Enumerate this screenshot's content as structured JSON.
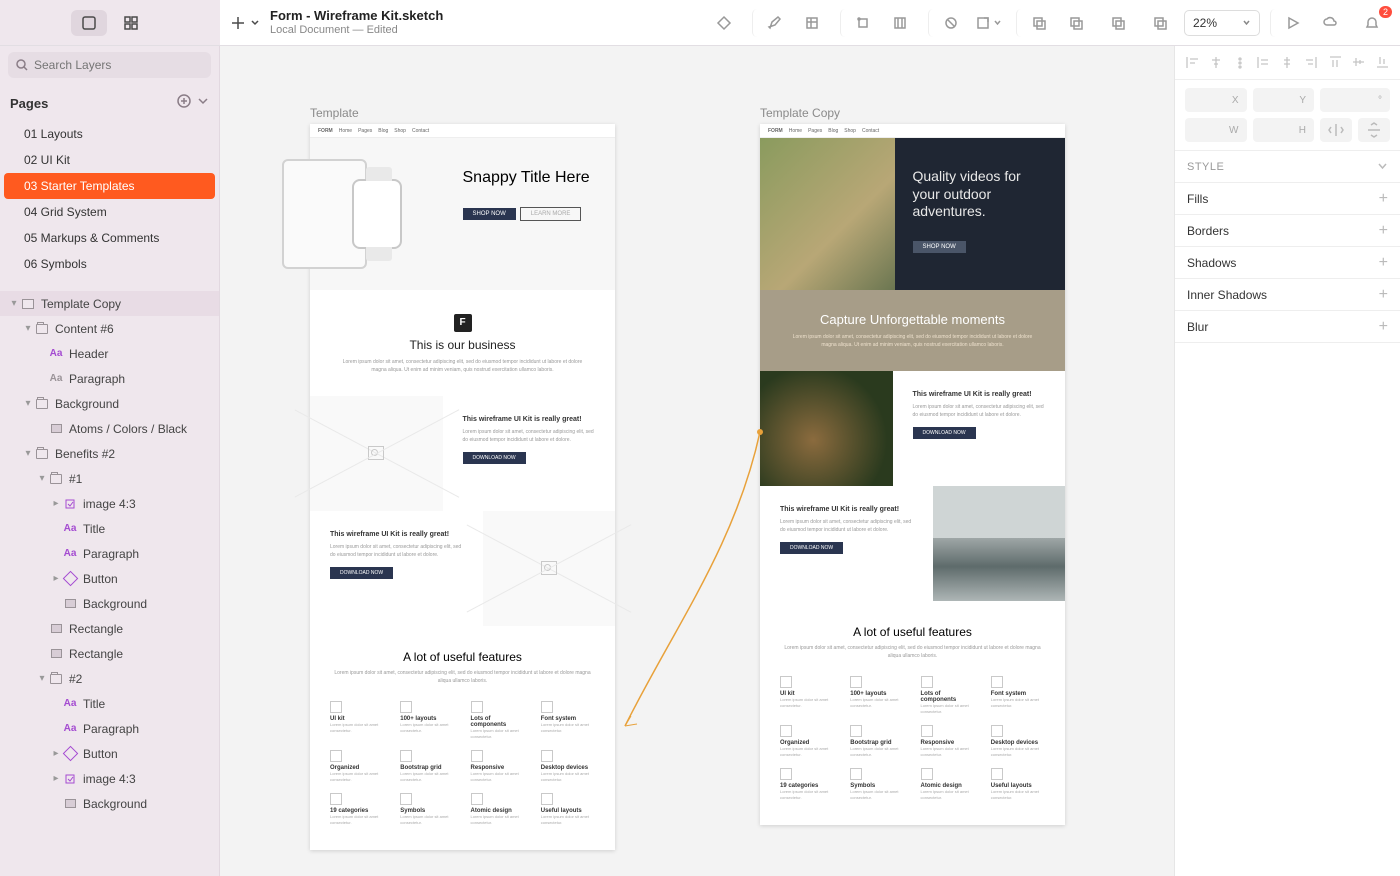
{
  "doc": {
    "title": "Form - Wireframe Kit.sketch",
    "subtitle": "Local Document — Edited"
  },
  "zoom": "22%",
  "notif_count": "2",
  "search_placeholder": "Search Layers",
  "pages_label": "Pages",
  "pages": [
    "01 Layouts",
    "02 UI Kit",
    "03 Starter Templates",
    "04 Grid System",
    "05 Markups & Comments",
    "06 Symbols"
  ],
  "active_page_index": 2,
  "layers": [
    {
      "d": 0,
      "kind": "artboard",
      "label": "Template Copy",
      "open": true,
      "sel": true
    },
    {
      "d": 1,
      "kind": "folder",
      "label": "Content #6",
      "open": true
    },
    {
      "d": 2,
      "kind": "text",
      "label": "Header"
    },
    {
      "d": 2,
      "kind": "textgrey",
      "label": "Paragraph"
    },
    {
      "d": 1,
      "kind": "folder",
      "label": "Background",
      "open": true
    },
    {
      "d": 2,
      "kind": "rect",
      "label": "Atoms / Colors / Black"
    },
    {
      "d": 1,
      "kind": "folder",
      "label": "Benefits #2",
      "open": true
    },
    {
      "d": 2,
      "kind": "folder",
      "label": "#1",
      "open": true
    },
    {
      "d": 3,
      "kind": "symbol",
      "label": "image 4:3",
      "closed": true
    },
    {
      "d": 3,
      "kind": "text",
      "label": "Title"
    },
    {
      "d": 3,
      "kind": "text",
      "label": "Paragraph"
    },
    {
      "d": 3,
      "kind": "diamond",
      "label": "Button",
      "closed": true
    },
    {
      "d": 3,
      "kind": "rect",
      "label": "Background"
    },
    {
      "d": 2,
      "kind": "rect",
      "label": "Rectangle"
    },
    {
      "d": 2,
      "kind": "rect",
      "label": "Rectangle"
    },
    {
      "d": 2,
      "kind": "folder",
      "label": "#2",
      "open": true
    },
    {
      "d": 3,
      "kind": "text",
      "label": "Title"
    },
    {
      "d": 3,
      "kind": "text",
      "label": "Paragraph"
    },
    {
      "d": 3,
      "kind": "diamond",
      "label": "Button",
      "closed": true
    },
    {
      "d": 3,
      "kind": "symbol",
      "label": "image 4:3",
      "closed": true
    },
    {
      "d": 3,
      "kind": "rect",
      "label": "Background"
    }
  ],
  "inspector": {
    "pos_labels": [
      "X",
      "Y",
      "°",
      "W",
      "H"
    ],
    "style_label": "STYLE",
    "sections": [
      "Fills",
      "Borders",
      "Shadows",
      "Inner Shadows",
      "Blur"
    ]
  },
  "canvas": {
    "art1_label": "Template",
    "art2_label": "Template Copy",
    "hero1_title": "Snappy Title Here",
    "hero2_title": "Quality videos for your outdoor adventures.",
    "hero_btn1": "SHOP NOW",
    "hero_btn2": "LEARN MORE",
    "biz_title": "This is our business",
    "biz_title2": "Capture Unforgettable moments",
    "lorem": "Lorem ipsum dolor sit amet, consectetur adipiscing elit, sed do eiusmod tempor incididunt ut labore et dolore magna aliqua. Ut enim ad minim veniam, quis nostrud exercitation ullamco laboris.",
    "ben_h": "This wireframe UI Kit is really great!",
    "ben_p": "Lorem ipsum dolor sit amet, consectetur adipiscing elit, sed do eiusmod tempor incididunt ut labore et dolore.",
    "ben_btn": "DOWNLOAD NOW",
    "feat_h": "A lot of useful features",
    "feat_sub": "Lorem ipsum dolor sit amet, consectetur adipiscing elit, sed do eiusmod tempor incididunt ut labore et dolore magna aliqua ullamco laboris.",
    "features": [
      "UI kit",
      "100+ layouts",
      "Lots of components",
      "Font system",
      "Organized",
      "Bootstrap grid",
      "Responsive",
      "Desktop devices",
      "19 categories",
      "Symbols",
      "Atomic design",
      "Useful layouts"
    ],
    "nav_logo": "FORM",
    "nav_items": [
      "Home",
      "Pages",
      "Blog",
      "Shop",
      "Contact"
    ]
  }
}
